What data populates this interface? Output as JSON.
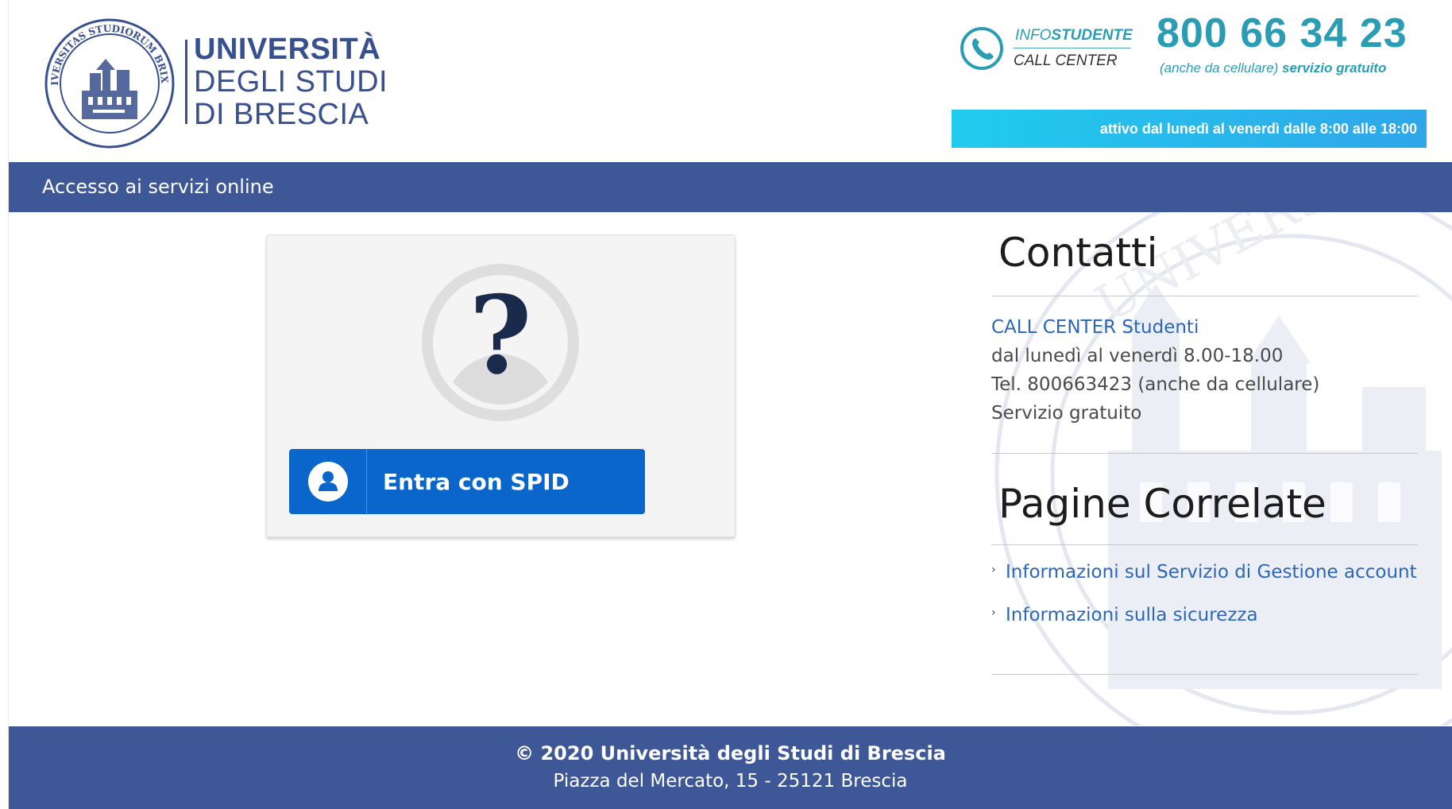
{
  "header": {
    "logo": {
      "seal_text": "UNIVERSITAS STUDIORUM BRIXIAE",
      "line1": "UNIVERSITÀ",
      "line2": "DEGLI STUDI",
      "line3": "DI BRESCIA"
    },
    "callcenter": {
      "info_prefix": "INFO",
      "info_suffix": "STUDENTE",
      "label": "CALL CENTER",
      "number": "800 66 34 23",
      "note_italic": "(anche da cellulare)",
      "note_bold": "servizio gratuito",
      "hours": "attivo dal lunedì al venerdì dalle 8:00 alle 18:00"
    }
  },
  "nav": {
    "title": "Accesso ai servizi online"
  },
  "login": {
    "spid_button_label": "Entra con SPID"
  },
  "contacts": {
    "title": "Contatti",
    "link": "CALL CENTER Studenti",
    "lines": [
      "dal lunedì al venerdì 8.00-18.00",
      "Tel. 800663423 (anche da cellulare)",
      "Servizio gratuito"
    ]
  },
  "related": {
    "title": "Pagine Correlate",
    "links": [
      "Informazioni sul Servizio di Gestione account",
      "Informazioni sulla sicurezza"
    ]
  },
  "footer": {
    "copyright": "© 2020 Università degli Studi di Brescia",
    "address": "Piazza del Mercato, 15 - 25121 Brescia"
  },
  "colors": {
    "brand_blue": "#3e5796",
    "accent_teal": "#2a9db4",
    "spid_blue": "#0b66cc",
    "link_blue": "#2b66b7"
  },
  "icons": [
    "university-seal-icon",
    "phone-icon",
    "unknown-user-avatar-icon",
    "spid-user-icon",
    "chevron-right-icon"
  ]
}
